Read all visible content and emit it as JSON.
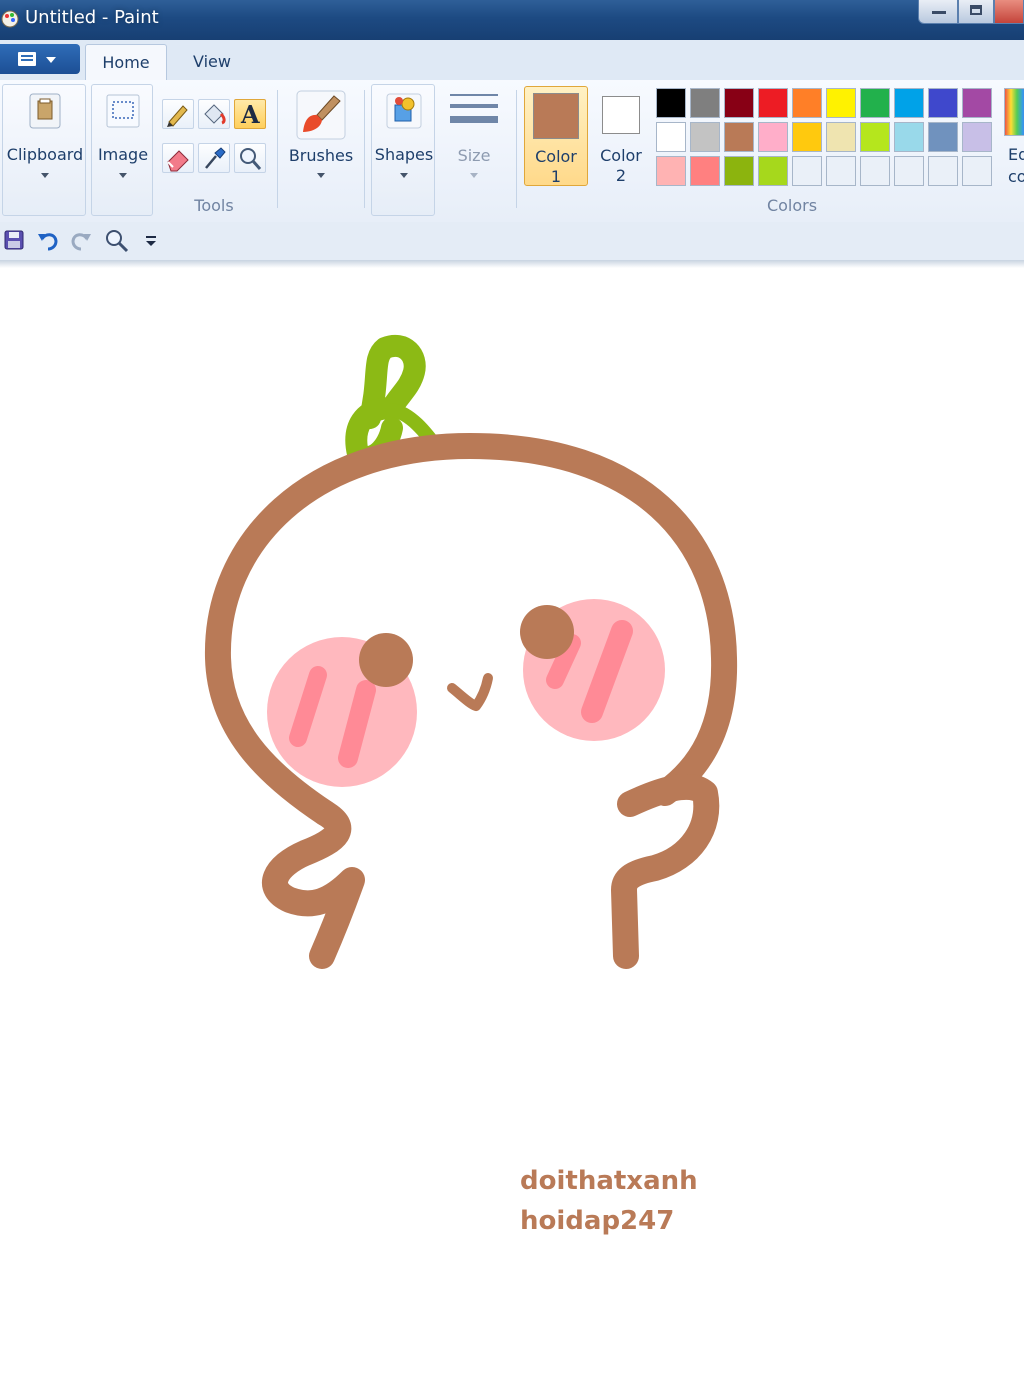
{
  "window": {
    "title": "Untitled - Paint"
  },
  "tabs": [
    {
      "label": "Home",
      "active": true
    },
    {
      "label": "View",
      "active": false
    }
  ],
  "ribbon": {
    "clipboard": "Clipboard",
    "image": "Image",
    "tools_group": "Tools",
    "brushes": "Brushes",
    "shapes": "Shapes",
    "size": "Size",
    "color1": {
      "line1": "Color",
      "line2": "1",
      "value": "#b97a57"
    },
    "color2": {
      "line1": "Color",
      "line2": "2",
      "value": "#ffffff"
    },
    "colors_group": "Colors",
    "edit_colors": {
      "line1": "Ed",
      "line2": "co"
    },
    "palette": [
      [
        "#000000",
        "#7f7f7f",
        "#880015",
        "#ed1c24",
        "#ff7f27",
        "#fff200",
        "#22b14c",
        "#00a2e8",
        "#3f48cc",
        "#a349a4"
      ],
      [
        "#ffffff",
        "#c3c3c3",
        "#b97a57",
        "#ffaec9",
        "#ffc90e",
        "#efe4b0",
        "#b5e61d",
        "#99d9ea",
        "#7092be",
        "#c8bfe7"
      ],
      [
        "#ffb3b3",
        "#ff8080",
        "#8cb40e",
        "#a6d81c",
        "#eaf0f8",
        "#eaf0f8",
        "#eaf0f8",
        "#eaf0f8",
        "#eaf0f8",
        "#eaf0f8"
      ]
    ]
  },
  "canvas": {
    "text_lines": [
      "doithatxanh",
      "hoidap247"
    ],
    "colors": {
      "outline": "#b97a57",
      "sprout": "#8cba15",
      "cheek": "#ffb8be",
      "blush": "#ff8a96",
      "eye": "#b97a57"
    }
  }
}
